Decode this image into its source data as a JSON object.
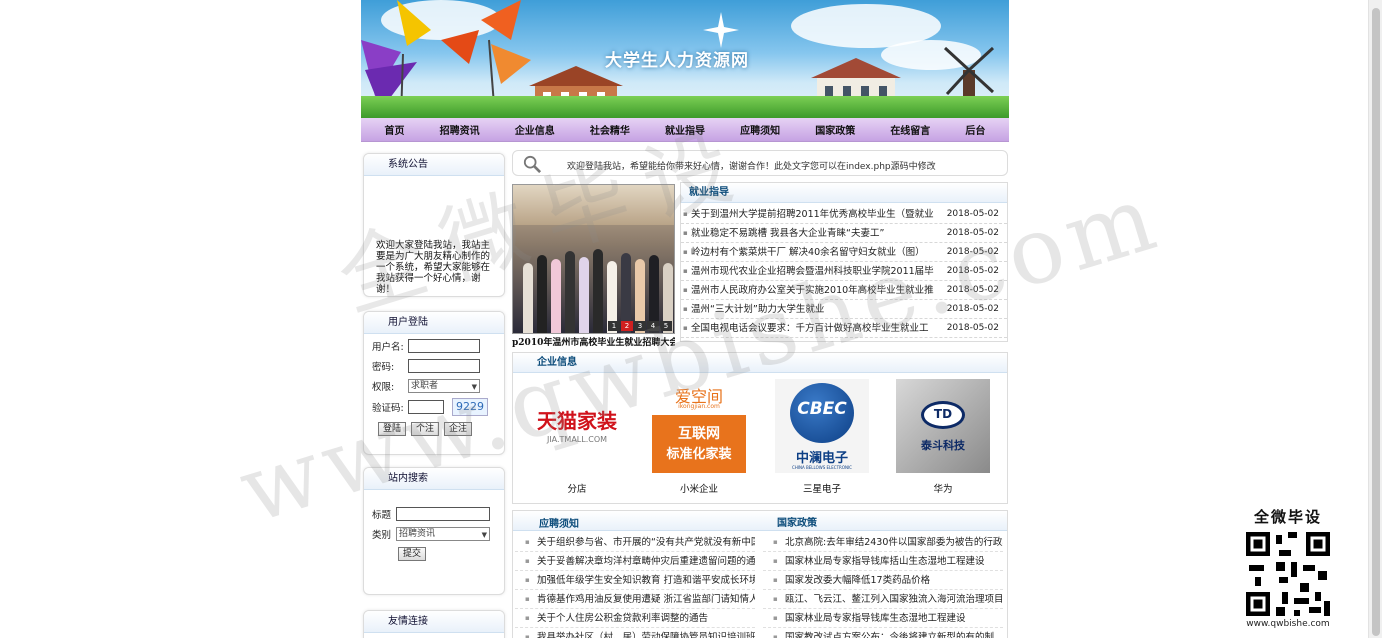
{
  "banner": {
    "title": "大学生人力资源网"
  },
  "nav": [
    "首页",
    "招聘资讯",
    "企业信息",
    "社会精华",
    "就业指导",
    "应聘须知",
    "国家政策",
    "在线留言",
    "后台"
  ],
  "notice": {
    "title": "系统公告",
    "text": "欢迎大家登陆我站，我站主要是为广大朋友精心制作的一个系统，希望大家能够在我站获得一个好心情，谢谢！"
  },
  "login": {
    "title": "用户登陆",
    "username_label": "用户名:",
    "password_label": "密码:",
    "role_label": "权限:",
    "role_value": "求职者",
    "captcha_label": "验证码:",
    "captcha_value": "9229",
    "login_btn": "登陆",
    "personal_btn": "个注",
    "company_btn": "企注"
  },
  "site_search": {
    "title": "站内搜索",
    "keyword_label": "标题",
    "category_label": "类别",
    "category_value": "招聘资讯",
    "submit": "提交"
  },
  "links": {
    "title": "友情连接"
  },
  "marquee": "欢迎登陆我站，希望能给你带来好心情，谢谢合作！此处文字您可以在index.php源码中修改",
  "photo": {
    "caption": "p2010年温州市高校毕业生就业招聘大会",
    "pages": [
      "1",
      "2",
      "3",
      "4",
      "5"
    ],
    "active_page": "2"
  },
  "guidance": {
    "title": "就业指导",
    "items": [
      {
        "title": "关于到温州大学提前招聘2011年优秀高校毕业生（暨就业",
        "date": "2018-05-02"
      },
      {
        "title": "就业稳定不易跳槽 我县各大企业青睐“夫妻工”",
        "date": "2018-05-02"
      },
      {
        "title": "岭边村有个紫菜烘干厂 解决40余名留守妇女就业（图）",
        "date": "2018-05-02"
      },
      {
        "title": "温州市现代农业企业招聘会暨温州科技职业学院2011届毕",
        "date": "2018-05-02"
      },
      {
        "title": "温州市人民政府办公室关于实施2010年高校毕业生就业推",
        "date": "2018-05-02"
      },
      {
        "title": "温州“三大计划”助力大学生就业",
        "date": "2018-05-02"
      },
      {
        "title": "全国电视电话会议要求：千方百计做好高校毕业生就业工",
        "date": "2018-05-02"
      }
    ]
  },
  "companies": {
    "title": "企业信息",
    "items": [
      {
        "name": "分店",
        "logo_main": "天猫家装",
        "logo_sub": "JIA.TMALL.COM"
      },
      {
        "name": "小米企业",
        "logo_top": "爱空间",
        "logo_sub": "ikongjian.com",
        "logo_main": "互联网",
        "logo_main2": "标准化家装"
      },
      {
        "name": "三星电子",
        "logo_main": "CBEC",
        "logo_sub": "中澜电子",
        "logo_tiny": "CHINA BELLOWS ELECTRONIC"
      },
      {
        "name": "华为",
        "logo_main": "TD",
        "logo_sub": "泰斗科技"
      }
    ]
  },
  "apply_notes": {
    "title": "应聘须知",
    "items": [
      "关于组织参与省、市开展的“没有共产党就没有新中国",
      "关于妥善解决章均洋村章畴仲灾后重建遗留问题的通知",
      "加强低年级学生安全知识教育 打造和谐平安成长环境",
      "肯德基作鸡用油反复使用遭疑 浙江省监部门请知情人�",
      "关于个人住房公积金贷款利率调整的通告",
      "我县举办社区（村、居）劳动保障协管员知识培训班"
    ]
  },
  "policy": {
    "title": "国家政策",
    "items": [
      "北京高院:去年审结2430件以国家部委为被告的行政案�",
      "国家林业局专家指导钱库括山生态湿地工程建设",
      "国家发改委大幅降低17类药品价格",
      "瓯江、飞云江、鳌江列入国家独流入海河流治理项目",
      "国家林业局专家指导钱库生态湿地工程建设",
      "国家教改试点方案公布：今後将建立新型的有的制"
    ]
  },
  "watermark": {
    "line1": "www.qwbishe.com",
    "line2": "全微毕设"
  },
  "qr": {
    "caption": "全微毕设",
    "url": "www.qwbishe.com"
  }
}
